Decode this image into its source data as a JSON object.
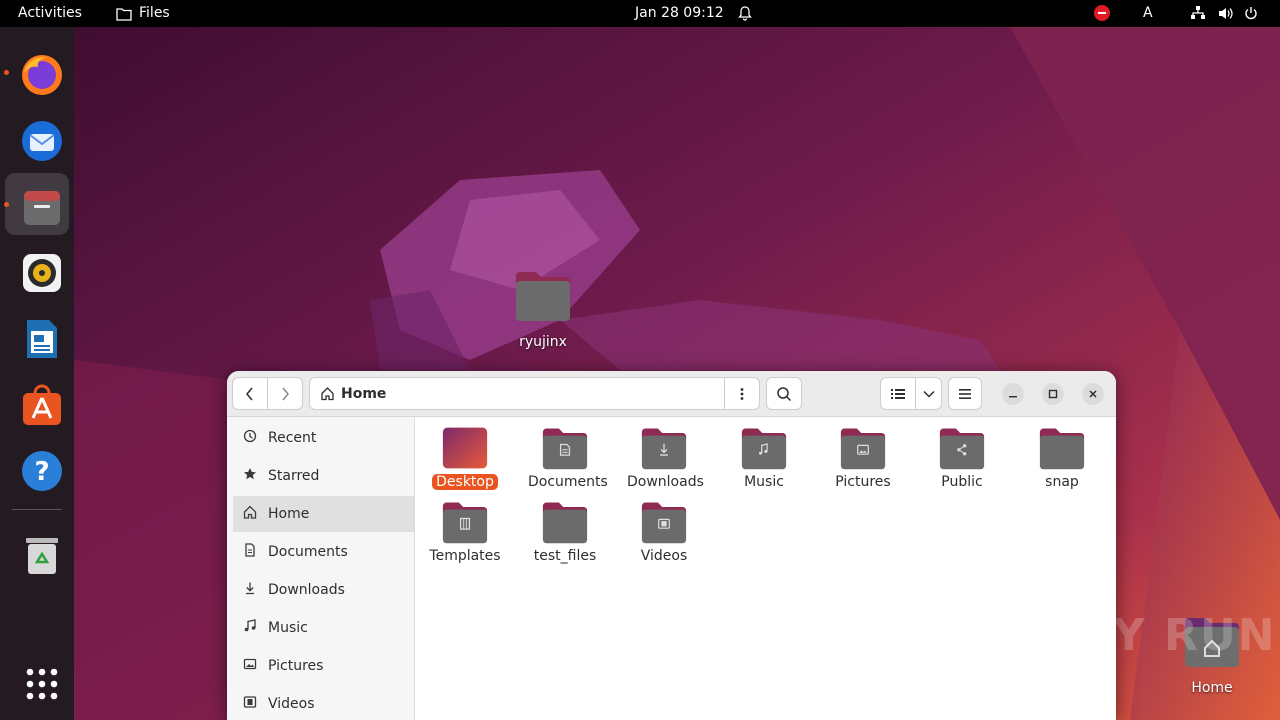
{
  "topbar": {
    "activities": "Activities",
    "app_name": "Files",
    "clock": "Jan 28  09:12",
    "keyboard_layout": "A"
  },
  "dock": {
    "items": [
      {
        "name": "firefox-icon",
        "running": true
      },
      {
        "name": "thunderbird-icon",
        "running": false
      },
      {
        "name": "files-icon",
        "running": true,
        "active": true
      },
      {
        "name": "rhythmbox-icon",
        "running": false
      },
      {
        "name": "libreoffice-writer-icon",
        "running": false
      },
      {
        "name": "software-center-icon",
        "running": false
      },
      {
        "name": "help-icon",
        "running": false
      },
      {
        "name": "trash-icon",
        "running": false
      },
      {
        "name": "show-apps-icon",
        "running": false
      }
    ]
  },
  "desktop": {
    "icons": [
      {
        "label": "ryujinx"
      },
      {
        "label": "Home"
      }
    ],
    "watermark": "ANY RUN"
  },
  "window": {
    "path": "Home",
    "sidebar": [
      {
        "label": "Recent",
        "icon": "clock-icon"
      },
      {
        "label": "Starred",
        "icon": "star-icon"
      },
      {
        "label": "Home",
        "icon": "home-icon",
        "active": true
      },
      {
        "label": "Documents",
        "icon": "document-icon"
      },
      {
        "label": "Downloads",
        "icon": "download-icon"
      },
      {
        "label": "Music",
        "icon": "music-icon"
      },
      {
        "label": "Pictures",
        "icon": "picture-icon"
      },
      {
        "label": "Videos",
        "icon": "video-icon"
      }
    ],
    "files": [
      {
        "label": "Desktop",
        "selected": true,
        "emblem": "none"
      },
      {
        "label": "Documents",
        "emblem": "document"
      },
      {
        "label": "Downloads",
        "emblem": "download"
      },
      {
        "label": "Music",
        "emblem": "music"
      },
      {
        "label": "Pictures",
        "emblem": "picture"
      },
      {
        "label": "Public",
        "emblem": "share"
      },
      {
        "label": "snap",
        "emblem": "none"
      },
      {
        "label": "Templates",
        "emblem": "template"
      },
      {
        "label": "test_files",
        "emblem": "none"
      },
      {
        "label": "Videos",
        "emblem": "video"
      }
    ]
  },
  "colors": {
    "accent": "#e95420",
    "folder_top": "#8f2a52",
    "folder_body": "#6b6b6b"
  }
}
